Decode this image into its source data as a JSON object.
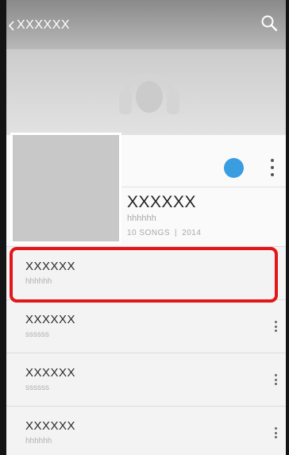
{
  "topbar": {
    "title": "XXXXXX",
    "back_icon": "chevron-left-icon",
    "search_icon": "search-icon"
  },
  "header": {
    "artwork_icon": "headphones-icon"
  },
  "album": {
    "title": "XXXXXX",
    "artist": "hhhhhh",
    "songs_count": "10 SONGS",
    "separator": "|",
    "year": "2014",
    "accent_color": "#3a9de0",
    "menu_icon": "more-vert-icon"
  },
  "songs": [
    {
      "title": "XXXXXX",
      "artist": "hhhhhh"
    },
    {
      "title": "XXXXXX",
      "artist": "ssssss"
    },
    {
      "title": "XXXXXX",
      "artist": "ssssss"
    },
    {
      "title": "XXXXXX",
      "artist": "hhhhhh"
    }
  ],
  "annotation": {
    "color": "#e3171a"
  }
}
